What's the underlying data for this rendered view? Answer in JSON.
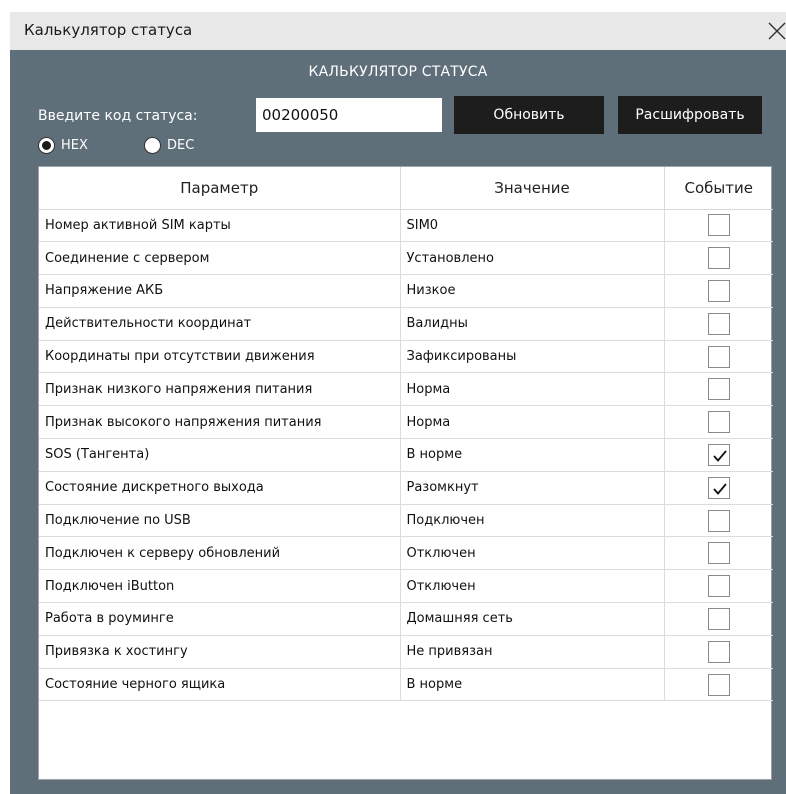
{
  "window": {
    "title": "Калькулятор статуса",
    "heading": "КАЛЬКУЛЯТОР СТАТУСА"
  },
  "form": {
    "code_label": "Введите код статуса:",
    "code_value": "00200050",
    "update_label": "Обновить",
    "decode_label": "Расшифровать",
    "radio_options": [
      "HEX",
      "DEC"
    ],
    "selected_radio": "HEX"
  },
  "table": {
    "headers": [
      "Параметр",
      "Значение",
      "Событие"
    ],
    "rows": [
      {
        "param": "Номер активной SIM карты",
        "value": "SIM0",
        "event": false
      },
      {
        "param": "Соединение с сервером",
        "value": "Установлено",
        "event": false
      },
      {
        "param": "Напряжение АКБ",
        "value": "Низкое",
        "event": false
      },
      {
        "param": "Действительности координат",
        "value": "Валидны",
        "event": false
      },
      {
        "param": "Координаты при отсутствии движения",
        "value": "Зафиксированы",
        "event": false
      },
      {
        "param": "Признак низкого напряжения питания",
        "value": "Норма",
        "event": false
      },
      {
        "param": "Признак высокого напряжения питания",
        "value": "Норма",
        "event": false
      },
      {
        "param": "SOS (Тангента)",
        "value": "В норме",
        "event": true
      },
      {
        "param": "Состояние дискретного выхода",
        "value": "Разомкнут",
        "event": true
      },
      {
        "param": "Подключение по USB",
        "value": "Подключен",
        "event": false
      },
      {
        "param": "Подключен к серверу обновлений",
        "value": "Отключен",
        "event": false
      },
      {
        "param": "Подключен iButton",
        "value": "Отключен",
        "event": false
      },
      {
        "param": "Работа в роуминге",
        "value": "Домашняя сеть",
        "event": false
      },
      {
        "param": "Привязка к хостингу",
        "value": "Не привязан",
        "event": false
      },
      {
        "param": "Состояние черного ящика",
        "value": "В норме",
        "event": false
      }
    ]
  },
  "icons": {
    "close": "close-icon",
    "checkmark": "checkmark-icon"
  },
  "colors": {
    "window_bg": "#5f6f79",
    "titlebar_bg": "#e8e8e8",
    "button_bg": "#1d1d1d"
  }
}
